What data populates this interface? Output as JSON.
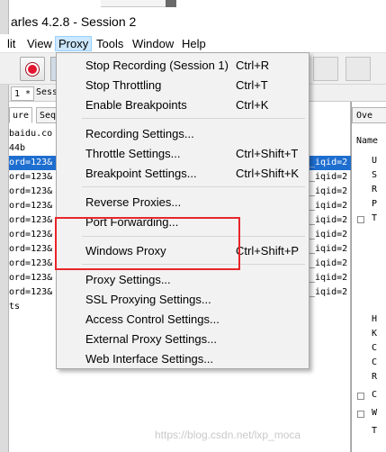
{
  "window": {
    "title": "arles 4.2.8 - Session 2"
  },
  "menubar": {
    "items": [
      "lit",
      "View",
      "Proxy",
      "Tools",
      "Window",
      "Help"
    ]
  },
  "toolbar": {
    "record_icon": "record-icon"
  },
  "session_tab": {
    "label": "1 *",
    "next": "Sess"
  },
  "left_tabs": [
    "ure",
    "Seq"
  ],
  "left_rows": [
    {
      "left": " baidu.co",
      "right": "",
      "selected": false
    },
    {
      "left": "44b",
      "right": "",
      "selected": false
    },
    {
      "left": "ord=123&",
      "right": "_iqid=2",
      "selected": true
    },
    {
      "left": "ord=123&",
      "right": "_iqid=2",
      "selected": false
    },
    {
      "left": "ord=123&",
      "right": "_iqid=2",
      "selected": false
    },
    {
      "left": "ord=123&",
      "right": "_iqid=2",
      "selected": false
    },
    {
      "left": "ord=123&",
      "right": "_iqid=2",
      "selected": false
    },
    {
      "left": "ord=123&",
      "right": "_iqid=2",
      "selected": false
    },
    {
      "left": "ord=123&",
      "right": "_iqid=2",
      "selected": false
    },
    {
      "left": "ord=123&",
      "right": "_iqid=2",
      "selected": false
    },
    {
      "left": "ord=123&",
      "right": "_iqid=2",
      "selected": false
    },
    {
      "left": "ord=123&",
      "right": "_iqid=2",
      "selected": false
    },
    {
      "left": "ts",
      "right": "",
      "selected": false
    }
  ],
  "right_pane": {
    "header": "Ove",
    "name_label": "Name",
    "items": [
      "U",
      "S",
      "R",
      "P",
      "T",
      "",
      "",
      "",
      "",
      "",
      "",
      "H",
      "K",
      "C",
      "C",
      "R",
      "C",
      "W",
      "T"
    ]
  },
  "proxy_menu": {
    "items": [
      {
        "label": "Stop Recording (Session 1)",
        "shortcut": "Ctrl+R"
      },
      {
        "label": "Stop Throttling",
        "shortcut": "Ctrl+T"
      },
      {
        "label": "Enable Breakpoints",
        "shortcut": "Ctrl+K"
      },
      {
        "label": "Recording Settings...",
        "shortcut": ""
      },
      {
        "label": "Throttle Settings...",
        "shortcut": "Ctrl+Shift+T"
      },
      {
        "label": "Breakpoint Settings...",
        "shortcut": "Ctrl+Shift+K"
      },
      {
        "label": "Reverse Proxies...",
        "shortcut": ""
      },
      {
        "label": "Port Forwarding...",
        "shortcut": ""
      },
      {
        "label": "Windows Proxy",
        "shortcut": "Ctrl+Shift+P"
      },
      {
        "label": "Proxy Settings...",
        "shortcut": ""
      },
      {
        "label": "SSL Proxying Settings...",
        "shortcut": ""
      },
      {
        "label": "Access Control Settings...",
        "shortcut": ""
      },
      {
        "label": "External Proxy Settings...",
        "shortcut": ""
      },
      {
        "label": "Web Interface Settings...",
        "shortcut": ""
      }
    ]
  },
  "watermark": "https://blog.csdn.net/lxp_moca",
  "colors": {
    "selection": "#1e6ed0",
    "highlight": "#e8262a",
    "menu_bg": "#f2f2f2"
  }
}
